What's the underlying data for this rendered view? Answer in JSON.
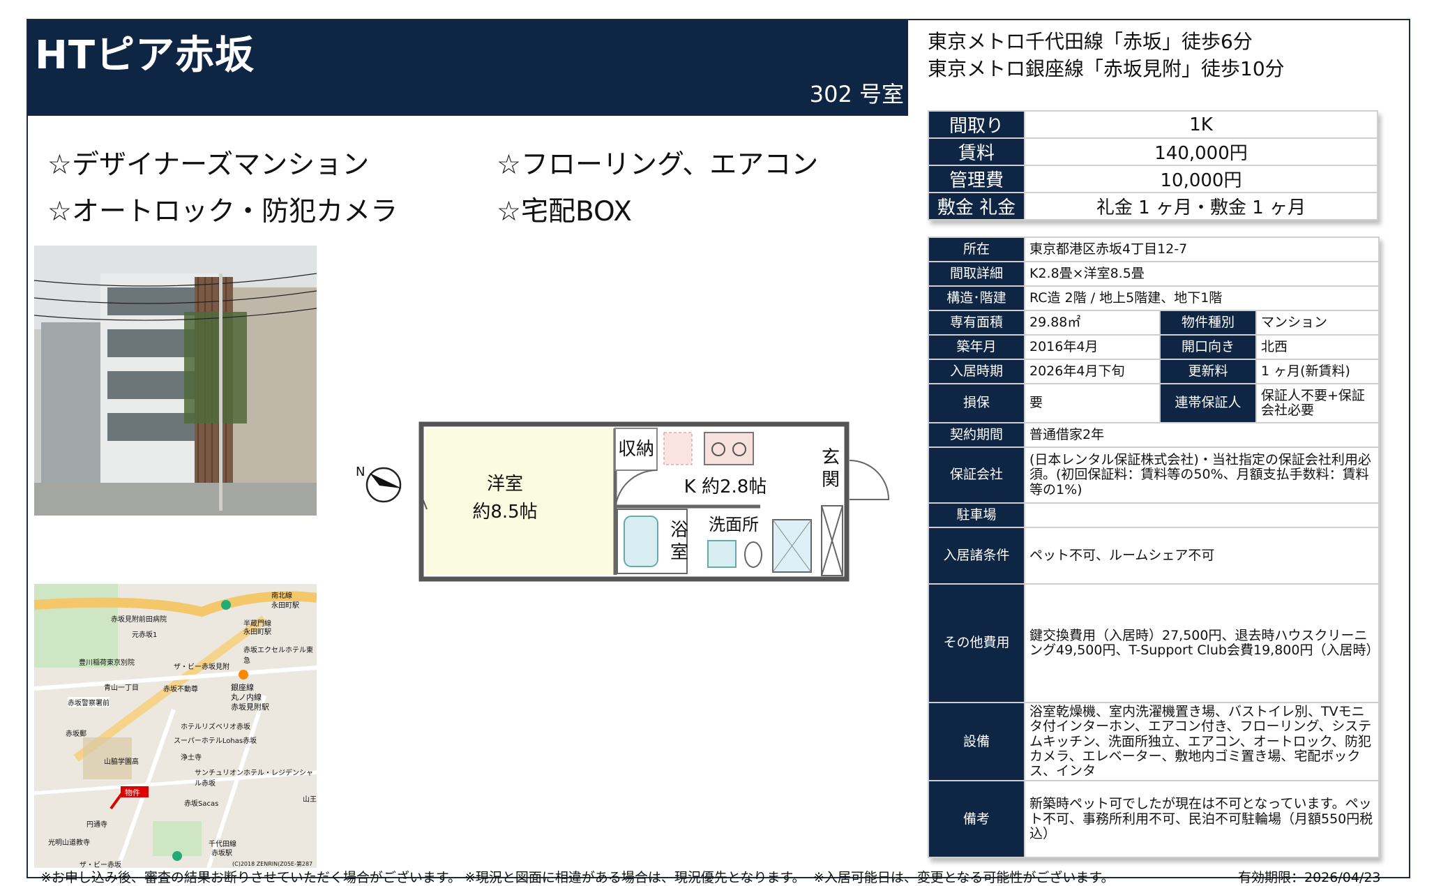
{
  "title": "HTピア赤坂",
  "room": "302 号室",
  "access": [
    "東京メトロ千代田線「赤坂」徒歩6分",
    "東京メトロ銀座線「赤坂見附」徒歩10分"
  ],
  "features": [
    "☆デザイナーズマンション",
    "☆フローリング、エアコン",
    "☆オートロック・防犯カメラ",
    "☆宅配BOX"
  ],
  "summary": [
    {
      "label": "間取り",
      "value": "1K"
    },
    {
      "label": "賃料",
      "value": "140,000円"
    },
    {
      "label": "管理費",
      "value": "10,000円"
    },
    {
      "label": "敷金 礼金",
      "value": "礼金 1 ヶ月・敷金 1 ヶ月"
    }
  ],
  "details": {
    "address_label": "所在",
    "address": "東京都港区赤坂4丁目12-7",
    "layout_label": "間取詳細",
    "layout": "K2.8畳×洋室8.5畳",
    "structure_label": "構造･階建",
    "structure": "RC造 2階 / 地上5階建、地下1階",
    "area_label": "専有面積",
    "area": "29.88㎡",
    "type_label": "物件種別",
    "type": "マンション",
    "built_label": "築年月",
    "built": "2016年4月",
    "facing_label": "開口向き",
    "facing": "北西",
    "movein_label": "入居時期",
    "movein": "2026年4月下旬",
    "renewal_label": "更新料",
    "renewal": "1 ヶ月(新賃料)",
    "insurance_label": "損保",
    "insurance": "要",
    "guarantor_label": "連帯保証人",
    "guarantor": "保証人不要+保証会社必要",
    "contract_label": "契約期間",
    "contract": "普通借家2年",
    "guarantee_co_label": "保証会社",
    "guarantee_co": "(日本レンタル保証株式会社)・当社指定の保証会社利用必須。(初回保証料：賃料等の50%、月額支払手数料：賃料等の1%)",
    "parking_label": "駐車場",
    "parking": "",
    "conditions_label": "入居諸条件",
    "conditions": "ペット不可、ルームシェア不可",
    "other_fees_label": "その他費用",
    "other_fees": "鍵交換費用（入居時）27,500円、退去時ハウスクリーニング49,500円、T-Support Club会費19,800円（入居時）",
    "equipment_label": "設備",
    "equipment": "浴室乾燥機、室内洗濯機置き場、バストイレ別、TVモニタ付インターホン、エアコン付き、フローリング、システムキッチン、洗面所独立、エアコン、オートロック、防犯カメラ、エレベーター、敷地内ゴミ置き場、宅配ボックス、インタ",
    "remarks_label": "備考",
    "remarks": "新築時ペット可でしたが現在は不可となっています。ペット不可、事務所利用不可、民泊不可駐輪場（月額550円税込）"
  },
  "floorplan": {
    "storage": "収納",
    "western_room": "洋室",
    "western_size": "約8.5帖",
    "kitchen": "K 約2.8帖",
    "entrance_1": "玄",
    "entrance_2": "関",
    "bath_1": "浴",
    "bath_2": "室",
    "washroom": "洗面所",
    "compass": "N"
  },
  "map": {
    "labels": [
      "南北線",
      "永田町駅",
      "半蔵門線",
      "永田町駅",
      "赤坂見附前田病院",
      "元赤坂1",
      "赤坂エクセルホテル東急",
      "豊川稲荷東京別院",
      "ザ・ビー赤坂見附",
      "青山一丁目",
      "赤坂不動尊",
      "銀座線",
      "丸ノ内線",
      "赤坂見附駅",
      "赤坂警察署前",
      "ホテルリズベリオ赤坂",
      "赤坂郵",
      "スーパーホテルLohas赤坂",
      "山脇学園高",
      "浄土寺",
      "サンチュリオンホテル・レジデンシャル赤坂",
      "物件",
      "赤坂Sacas",
      "千代田線",
      "赤坂駅",
      "円通寺",
      "光明山道教寺",
      "ザ・ビー赤坂",
      "山王",
      "(C)2018 ZENRIN(Z05E-第287号)"
    ],
    "pin_label": "物件"
  },
  "footer": {
    "note1": "※お申し込み後、審査の結果お断りさせていただく場合がございます。",
    "note2": "※現況と図面に相違がある場合は、現況優先となります。",
    "note3": "※入居可能日は、変更となる可能性がございます。",
    "validity": "有効期限：2026/04/23"
  }
}
